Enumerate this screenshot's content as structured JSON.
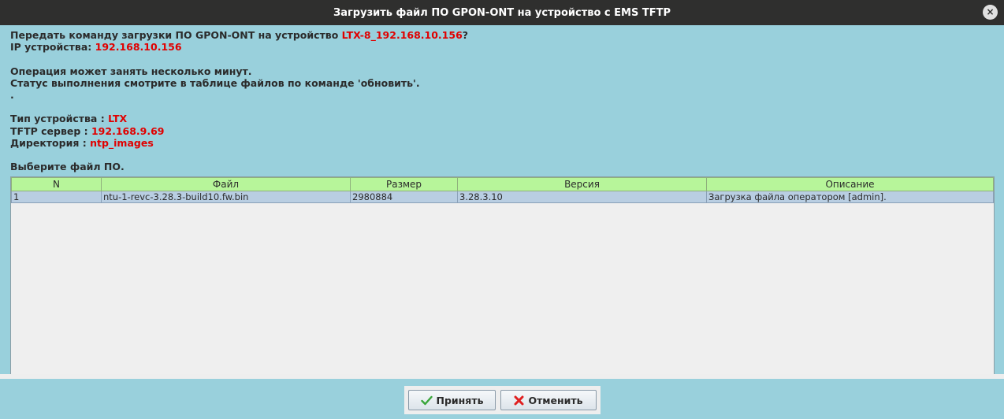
{
  "window": {
    "title": "Загрузить файл ПО GPON-ONT на устройство с EMS TFTP",
    "close_glyph": "×"
  },
  "message": {
    "line1_prefix": "Передать команду загрузки ПО GPON-ONT на устройство ",
    "device_name": "LTX-8_192.168.10.156",
    "line1_suffix": "?",
    "ip_label": "IP устройства: ",
    "ip_value": "192.168.10.156",
    "note1": "Операция может занять несколько минут.",
    "note2": "Статус выполнения смотрите в таблице файлов по команде 'обновить'.",
    "note3": ".",
    "type_label": "Тип устройства : ",
    "type_value": "LTX",
    "tftp_label": "TFTP сервер : ",
    "tftp_value": "192.168.9.69",
    "dir_label": "Директория : ",
    "dir_value": "ntp_images",
    "select_prompt": "Выберите файл ПО."
  },
  "table": {
    "columns": [
      "N",
      "Файл",
      "Размер",
      "Версия",
      "Описание"
    ],
    "rows": [
      [
        "1",
        "ntu-1-revc-3.28.3-build10.fw.bin",
        "2980884",
        "3.28.3.10",
        "Загрузка файла оператором [admin]."
      ]
    ]
  },
  "buttons": {
    "accept_label": "Принять",
    "cancel_label": "Отменить"
  },
  "colors": {
    "accent_red": "#e00000",
    "header_green": "#b7f59a",
    "selected_row": "#b9cee2",
    "background": "#99d0dc"
  },
  "icons": {
    "accept": "checkmark-icon",
    "cancel": "red-x-icon",
    "close": "close-icon"
  }
}
